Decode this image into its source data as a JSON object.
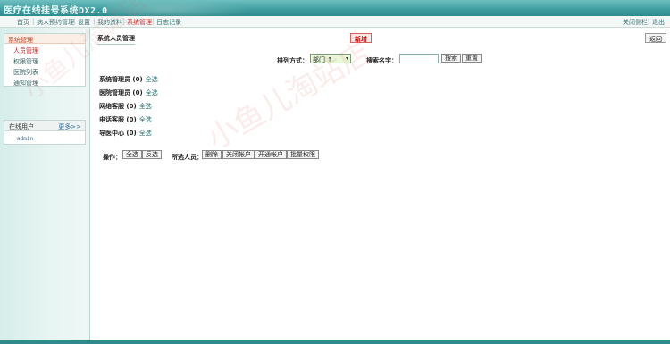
{
  "app": {
    "title": "医疗在线挂号系统DX2.0"
  },
  "topnav": {
    "items": [
      "首页",
      "病人预约管理",
      "设置",
      "我的资料",
      "系统管理",
      "日志记录"
    ],
    "right": [
      "关闭侧栏",
      "退出"
    ],
    "active": "系统管理"
  },
  "sidebar": {
    "menu_head": "系统管理",
    "items": [
      "人员管理",
      "权限管理",
      "医院列表",
      "通知管理"
    ],
    "online_title": "在线用户",
    "online_more": "更多>>",
    "online_user": "admin"
  },
  "main": {
    "title": "系统人员管理",
    "add_label": "新增",
    "back_label": "返回",
    "sort_label": "排列方式：",
    "sort_value": "部门 ↑",
    "search_label": "搜索名字：",
    "search_value": "",
    "search_btn": "搜索",
    "reset_btn": "重置",
    "groups": [
      {
        "name": "系统管理员 (0)",
        "select": "全选"
      },
      {
        "name": "医院管理员 (0)",
        "select": "全选"
      },
      {
        "name": "网络客服 (0)",
        "select": "全选"
      },
      {
        "name": "电话客服 (0)",
        "select": "全选"
      },
      {
        "name": "导医中心 (0)",
        "select": "全选"
      }
    ],
    "ops_label": "操作：",
    "ops_buttons": [
      "全选",
      "反选"
    ],
    "selected_label": "所选人员：",
    "selected_buttons": [
      "删除",
      "关闭帐户",
      "开通帐户",
      "批量权限"
    ]
  },
  "watermark": "小鱼儿淘站店"
}
